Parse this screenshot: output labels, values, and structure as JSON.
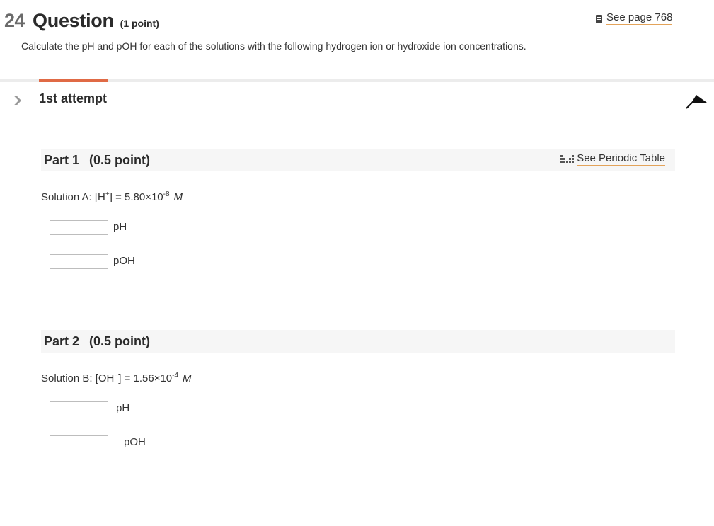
{
  "header": {
    "number": "24",
    "word": "Question",
    "points": "(1 point)",
    "see_page": "See page 768",
    "prompt": "Calculate the pH and pOH for each of the solutions with the following hydrogen ion or hydroxide ion concentrations."
  },
  "attempt": {
    "title": "1st attempt"
  },
  "parts": [
    {
      "title": "Part 1",
      "points": "(0.5 point)",
      "periodic_link": "See Periodic Table",
      "solution": {
        "prefix": "Solution A:  [H",
        "ion_sup": "+",
        "mid": "] = 5.80×10",
        "exp": "-8",
        "unit": "M"
      },
      "fields": [
        {
          "label": "pH",
          "value": ""
        },
        {
          "label": "pOH",
          "value": ""
        }
      ]
    },
    {
      "title": "Part 2",
      "points": "(0.5 point)",
      "solution": {
        "prefix": "Solution B: [OH",
        "ion_sup": "−",
        "mid": "] = 1.56×10",
        "exp": "-4",
        "unit": "M"
      },
      "fields": [
        {
          "label": "pH",
          "value": ""
        },
        {
          "label": "pOH",
          "value": ""
        }
      ]
    }
  ],
  "colors": {
    "accent": "#e06a45",
    "link_underline": "#e3a35a",
    "part_bar": "#f6f6f6"
  },
  "icons": {
    "page": "book-icon",
    "table": "periodic-table-icon",
    "collapse": "chevron-down-icon",
    "pin": "pin-icon"
  }
}
